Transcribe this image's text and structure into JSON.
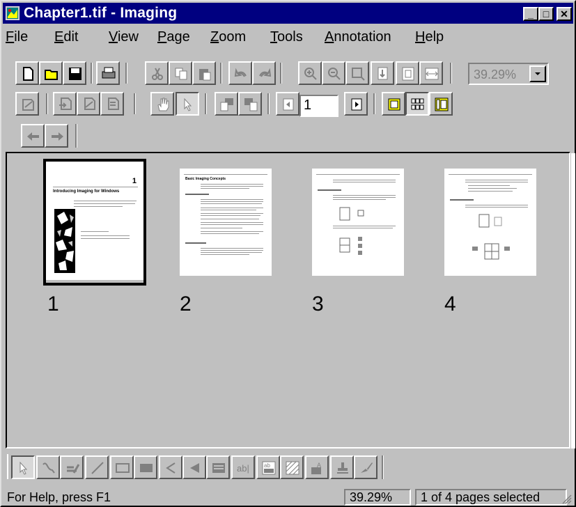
{
  "window": {
    "title": "Chapter1.tif - Imaging"
  },
  "menu": [
    {
      "label": "File",
      "accel": "F"
    },
    {
      "label": "Edit",
      "accel": "E"
    },
    {
      "label": "View",
      "accel": "V"
    },
    {
      "label": "Page",
      "accel": "P"
    },
    {
      "label": "Zoom",
      "accel": "Z"
    },
    {
      "label": "Tools",
      "accel": "T"
    },
    {
      "label": "Annotation",
      "accel": "A"
    },
    {
      "label": "Help",
      "accel": "H"
    }
  ],
  "toolbar": {
    "zoom_value": "39.29%",
    "page_number": "1"
  },
  "thumbnails": [
    {
      "number": "1",
      "heading_num": "1",
      "heading": "Introducing Imaging for Windows",
      "selected": true
    },
    {
      "number": "2",
      "heading": "Basic Imaging Concepts",
      "selected": false
    },
    {
      "number": "3",
      "heading": "",
      "selected": false
    },
    {
      "number": "4",
      "heading": "",
      "selected": false
    }
  ],
  "status": {
    "help": "For Help, press F1",
    "zoom": "39.29%",
    "pages": "1 of 4 pages selected"
  },
  "colors": {
    "titlebar": "#000080",
    "face": "#c0c0c0"
  }
}
